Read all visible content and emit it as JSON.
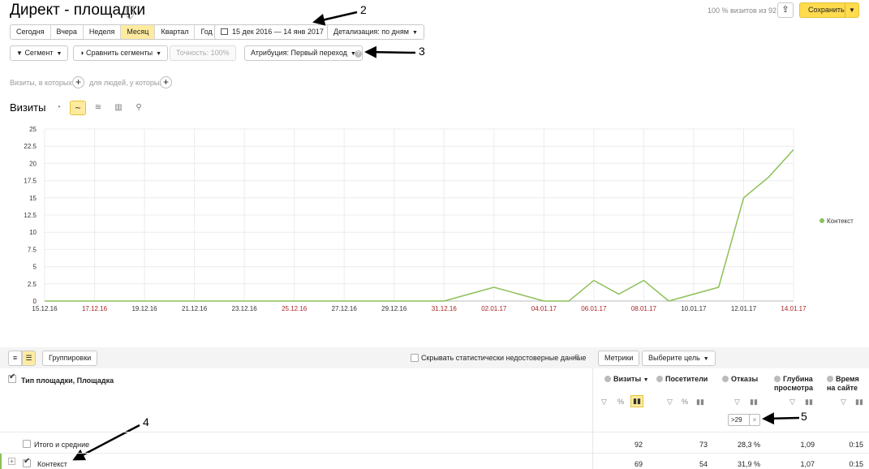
{
  "header": {
    "title": "Директ - площадки",
    "visits_share": "100 % визитов из 92",
    "export_icon": "share-icon",
    "save_label": "Сохранить"
  },
  "periods": [
    "Сегодня",
    "Вчера",
    "Неделя",
    "Месяц",
    "Квартал",
    "Год"
  ],
  "active_period": "Месяц",
  "date_range": "15 дек 2016 — 14 янв 2017",
  "detail_label": "Детализация: по дням",
  "segment_bar": {
    "segment": "Сегмент",
    "compare": "Сравнить сегменты",
    "accuracy": "Точность: 100%",
    "attribution": "Атрибуция: Первый переход",
    "help": "?"
  },
  "filter_line": {
    "visits_where": "Визиты, в которых",
    "people_where": "для людей, у которых"
  },
  "chart_title": "Визиты",
  "annotations": [
    "2",
    "3",
    "4",
    "5"
  ],
  "chart_data": {
    "type": "line",
    "x": [
      "15.12.16",
      "16.12.16",
      "17.12.16",
      "18.12.16",
      "19.12.16",
      "20.12.16",
      "21.12.16",
      "22.12.16",
      "23.12.16",
      "24.12.16",
      "25.12.16",
      "26.12.16",
      "27.12.16",
      "28.12.16",
      "29.12.16",
      "30.12.16",
      "31.12.16",
      "01.01.17",
      "02.01.17",
      "03.01.17",
      "04.01.17",
      "05.01.17",
      "06.01.17",
      "07.01.17",
      "08.01.17",
      "09.01.17",
      "10.01.17",
      "11.01.17",
      "12.01.17",
      "13.01.17",
      "14.01.17"
    ],
    "x_ticks": [
      "15.12.16",
      "17.12.16",
      "19.12.16",
      "21.12.16",
      "23.12.16",
      "25.12.16",
      "27.12.16",
      "29.12.16",
      "31.12.16",
      "02.01.17",
      "04.01.17",
      "06.01.17",
      "08.01.17",
      "10.01.17",
      "12.01.17",
      "14.01.17"
    ],
    "weekend_ticks": [
      "17.12.16",
      "25.12.16",
      "31.12.16",
      "02.01.17",
      "04.01.17",
      "06.01.17",
      "08.01.17",
      "14.01.17"
    ],
    "series": [
      {
        "name": "Контекст",
        "color": "#8dc058",
        "values": [
          0,
          0,
          0,
          0,
          0,
          0,
          0,
          0,
          0,
          0,
          0,
          0,
          0,
          0,
          0,
          0,
          0,
          1,
          2,
          1,
          0,
          0,
          3,
          1,
          3,
          0,
          1,
          2,
          15,
          18,
          22
        ]
      }
    ],
    "y_ticks": [
      "0",
      "2.5",
      "5",
      "7.5",
      "10",
      "12.5",
      "15",
      "17.5",
      "20",
      "22.5",
      "25"
    ],
    "ylim": [
      0,
      25
    ],
    "legend_position": "right",
    "grid": true
  },
  "table": {
    "groupings_label": "Группировки",
    "hide_unreliable": "Скрывать статистически недостоверные данные",
    "metrics_label": "Метрики",
    "goal_label": "Выберите цель",
    "dimension_header": "Тип площадки, Площадка",
    "columns": [
      {
        "label": "Визиты",
        "sort": "▼"
      },
      {
        "label": "Посетители"
      },
      {
        "label": "Отказы"
      },
      {
        "label": "Глубина просмотра"
      },
      {
        "label": "Время на сайте"
      }
    ],
    "filter_chip": ">29",
    "rows": [
      {
        "label": "Итого и средние",
        "values": [
          "92",
          "73",
          "28,3 %",
          "1,09",
          "0:15"
        ]
      },
      {
        "label": "Контекст",
        "values": [
          "69",
          "54",
          "31,9 %",
          "1,07",
          "0:15"
        ]
      }
    ]
  }
}
